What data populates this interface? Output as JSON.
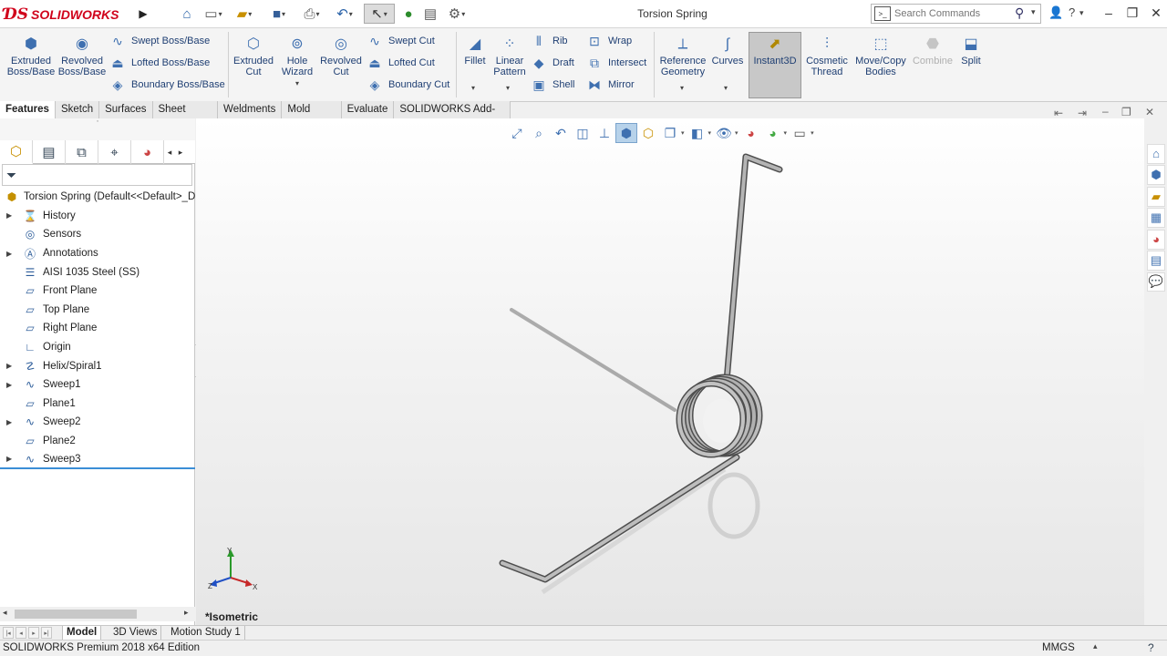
{
  "app": {
    "logo_ds": "ƊS",
    "logo_text": "SOLIDWORKS",
    "document_title": "Torsion Spring"
  },
  "search": {
    "placeholder": "Search Commands"
  },
  "command_manager": {
    "extruded_boss": "Extruded Boss/Base",
    "revolved_boss": "Revolved Boss/Base",
    "swept_boss": "Swept Boss/Base",
    "lofted_boss": "Lofted Boss/Base",
    "boundary_boss": "Boundary Boss/Base",
    "extruded_cut": "Extruded Cut",
    "hole_wizard": "Hole Wizard",
    "revolved_cut": "Revolved Cut",
    "swept_cut": "Swept Cut",
    "lofted_cut": "Lofted Cut",
    "boundary_cut": "Boundary Cut",
    "fillet": "Fillet",
    "linear_pattern": "Linear Pattern",
    "rib": "Rib",
    "draft": "Draft",
    "shell": "Shell",
    "wrap": "Wrap",
    "intersect": "Intersect",
    "mirror": "Mirror",
    "reference_geometry": "Reference Geometry",
    "curves": "Curves",
    "instant3d": "Instant3D",
    "cosmetic_thread": "Cosmetic Thread",
    "move_copy_bodies": "Move/Copy Bodies",
    "combine": "Combine",
    "split": "Split"
  },
  "tabs": [
    "Features",
    "Sketch",
    "Surfaces",
    "Sheet Metal",
    "Weldments",
    "Mold Tools",
    "Evaluate",
    "SOLIDWORKS Add-Ins"
  ],
  "feature_tree": {
    "root": "Torsion Spring  (Default<<Default>_D",
    "items": [
      "History",
      "Sensors",
      "Annotations",
      "AISI 1035 Steel (SS)",
      "Front Plane",
      "Top Plane",
      "Right Plane",
      "Origin",
      "Helix/Spiral1",
      "Sweep1",
      "Plane1",
      "Sweep2",
      "Plane2",
      "Sweep3"
    ]
  },
  "viewport": {
    "view_label": "*Isometric",
    "triad": {
      "x": "X",
      "y": "Y",
      "z": "Z"
    }
  },
  "bottom_tabs": [
    "Model",
    "3D Views",
    "Motion Study 1"
  ],
  "status": {
    "edition": "SOLIDWORKS Premium 2018 x64 Edition",
    "units": "MMGS"
  },
  "icons": {
    "home": "home-icon",
    "new": "new-document-icon",
    "open": "open-icon",
    "save": "save-icon",
    "print": "print-icon",
    "undo": "undo-icon",
    "select": "select-icon",
    "rebuild": "rebuild-icon",
    "file_props": "file-properties-icon",
    "options": "options-gear-icon",
    "help": "help-icon",
    "user": "user-icon"
  },
  "colors": {
    "brand_red": "#d0021b",
    "accent_blue": "#3f70b0",
    "selection_blue": "#3b8ed6",
    "spring_grey": "#a8a8a8"
  }
}
